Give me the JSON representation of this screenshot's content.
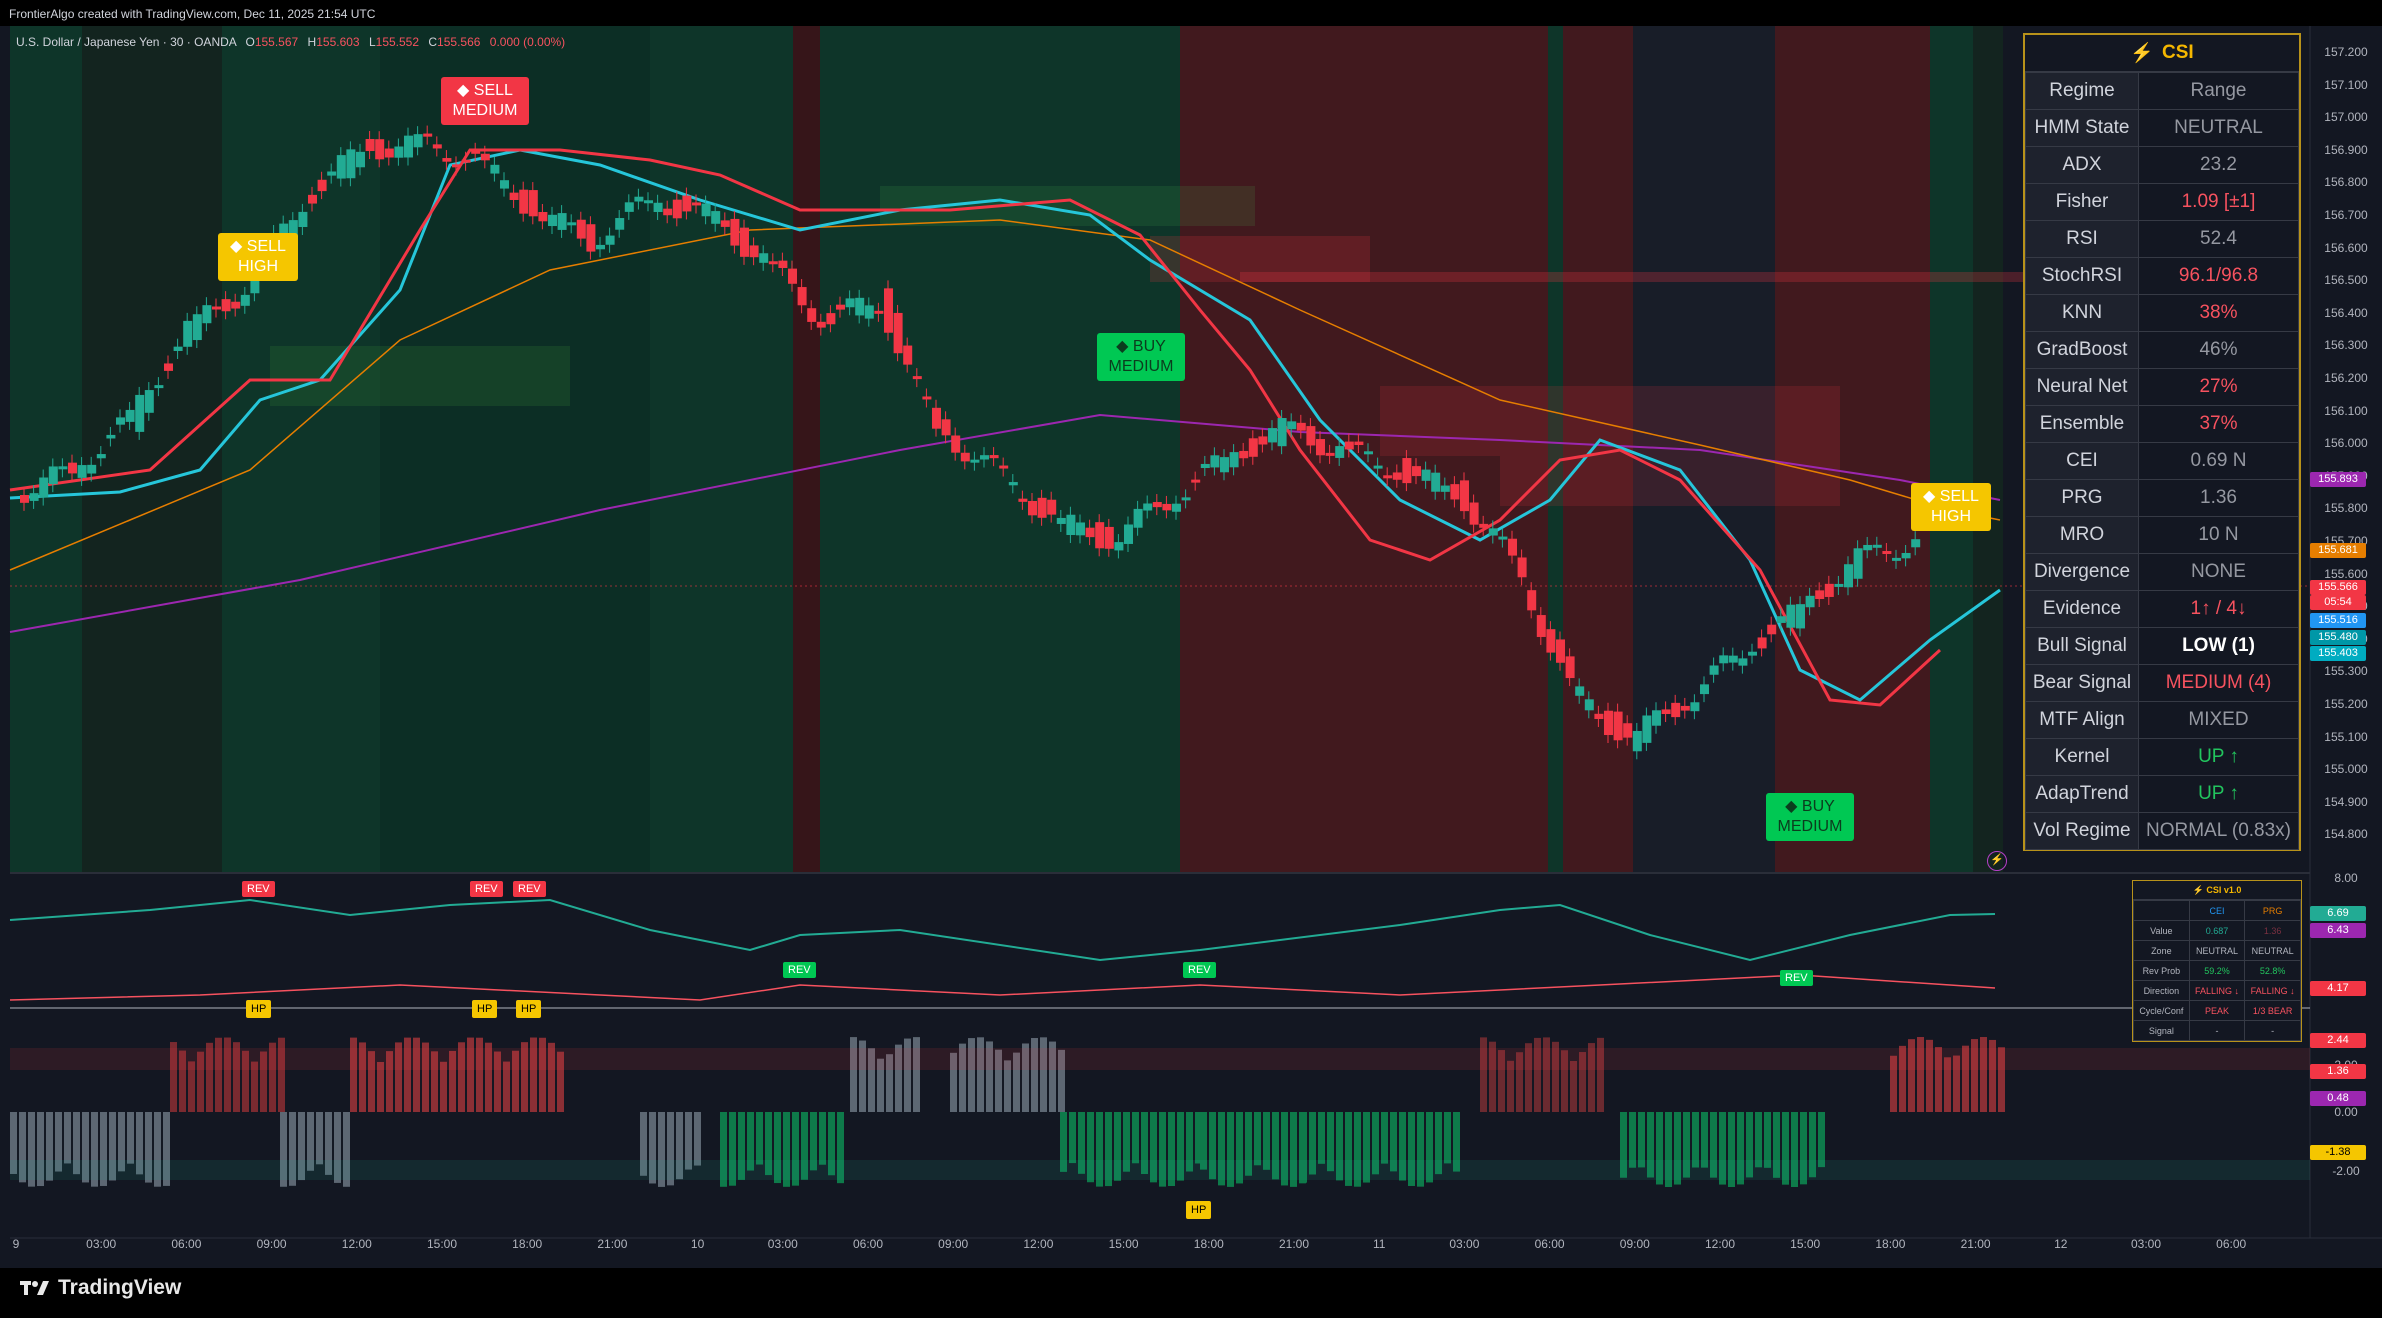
{
  "topbar": {
    "text": "FrontierAlgo created with TradingView.com, Dec 11, 2025 21:54 UTC"
  },
  "symbol": {
    "name": "U.S. Dollar / Japanese Yen · 30 · OANDA",
    "o_label": "O",
    "o": "155.567",
    "h_label": "H",
    "h": "155.603",
    "l_label": "L",
    "l": "155.552",
    "c_label": "C",
    "c": "155.566",
    "change": "0.000 (0.00%)"
  },
  "price_axis": [
    "157.200",
    "157.100",
    "157.000",
    "156.900",
    "156.800",
    "156.700",
    "156.600",
    "156.500",
    "156.400",
    "156.300",
    "156.200",
    "156.100",
    "156.000",
    "155.900",
    "155.800",
    "155.700",
    "155.600",
    "155.500",
    "155.400",
    "155.300",
    "155.200",
    "155.100",
    "155.000",
    "154.900",
    "154.800"
  ],
  "price_tags": [
    {
      "text": "155.893",
      "color": "#9c27b0"
    },
    {
      "text": "155.681",
      "color": "#e67e00"
    },
    {
      "text": "155.566",
      "color": "#f23645"
    },
    {
      "text": "05:54",
      "color": "#f23645"
    },
    {
      "text": "155.516",
      "color": "#2196f3"
    },
    {
      "text": "155.480",
      "color": "#0097a7"
    },
    {
      "text": "155.403",
      "color": "#00acc1"
    }
  ],
  "osc_axis": {
    "top": "8.00",
    "v1": "2.00",
    "v2": "0.00",
    "v3": "-2.00"
  },
  "osc_tags": [
    {
      "text": "6.69",
      "color": "#22ab94"
    },
    {
      "text": "6.43",
      "color": "#9c27b0"
    },
    {
      "text": "4.17",
      "color": "#f23645"
    },
    {
      "text": "2.44",
      "color": "#f23645"
    },
    {
      "text": "1.36",
      "color": "#f23645"
    },
    {
      "text": "0.48",
      "color": "#9c27b0"
    },
    {
      "text": "-1.38",
      "color": "#f5c600"
    }
  ],
  "time_axis": [
    "9",
    "03:00",
    "06:00",
    "09:00",
    "12:00",
    "15:00",
    "18:00",
    "21:00",
    "10",
    "03:00",
    "06:00",
    "09:00",
    "12:00",
    "15:00",
    "18:00",
    "21:00",
    "11",
    "03:00",
    "06:00",
    "09:00",
    "12:00",
    "15:00",
    "18:00",
    "21:00",
    "12",
    "03:00",
    "06:00"
  ],
  "signals": [
    {
      "line1": "◆ SELL",
      "line2": "HIGH",
      "bg": "#f5c600",
      "fg": "#ffffff"
    },
    {
      "line1": "◆ SELL",
      "line2": "MEDIUM",
      "bg": "#f23645",
      "fg": "#ffffff"
    },
    {
      "line1": "◆ BUY",
      "line2": "MEDIUM",
      "bg": "#00c853",
      "fg": "#0b3d1e"
    },
    {
      "line1": "◆ SELL",
      "line2": "HIGH",
      "bg": "#f5c600",
      "fg": "#ffffff"
    },
    {
      "line1": "◆ BUY",
      "line2": "MEDIUM",
      "bg": "#00c853",
      "fg": "#0b3d1e"
    }
  ],
  "rev_tags": [
    "REV",
    "REV",
    "REV",
    "REV",
    "REV",
    "REV"
  ],
  "hp_tags": [
    "HP",
    "HP",
    "HP",
    "HP"
  ],
  "csi": {
    "title": "CSI",
    "rows": [
      {
        "k": "Regime",
        "v": "Range",
        "c": "#9598a1"
      },
      {
        "k": "HMM State",
        "v": "NEUTRAL",
        "c": "#9598a1"
      },
      {
        "k": "ADX",
        "v": "23.2",
        "c": "#9598a1"
      },
      {
        "k": "Fisher",
        "v": "1.09 [±1]",
        "c": "#f7525f"
      },
      {
        "k": "RSI",
        "v": "52.4",
        "c": "#9598a1"
      },
      {
        "k": "StochRSI",
        "v": "96.1/96.8",
        "c": "#f7525f"
      },
      {
        "k": "KNN",
        "v": "38%",
        "c": "#f7525f"
      },
      {
        "k": "GradBoost",
        "v": "46%",
        "c": "#9598a1"
      },
      {
        "k": "Neural Net",
        "v": "27%",
        "c": "#f7525f"
      },
      {
        "k": "Ensemble",
        "v": "37%",
        "c": "#f7525f"
      },
      {
        "k": "CEI",
        "v": "0.69 N",
        "c": "#9598a1"
      },
      {
        "k": "PRG",
        "v": "1.36",
        "c": "#9598a1"
      },
      {
        "k": "MRO",
        "v": "10 N",
        "c": "#9598a1"
      },
      {
        "k": "Divergence",
        "v": "NONE",
        "c": "#9598a1"
      },
      {
        "k": "Evidence",
        "v": "1↑ / 4↓",
        "c": "#f7525f"
      },
      {
        "k": "Bull Signal",
        "v": "LOW (1)",
        "c": "#ffffff"
      },
      {
        "k": "Bear Signal",
        "v": "MEDIUM (4)",
        "c": "#f7525f"
      },
      {
        "k": "MTF Align",
        "v": "MIXED",
        "c": "#9598a1"
      },
      {
        "k": "Kernel",
        "v": "UP ↑",
        "c": "#22c55e"
      },
      {
        "k": "AdapTrend",
        "v": "UP ↑",
        "c": "#22c55e"
      },
      {
        "k": "Vol Regime",
        "v": "NORMAL (0.83x)",
        "c": "#9598a1"
      }
    ]
  },
  "mini": {
    "title": "⚡ CSI v1.0",
    "cols": [
      "",
      "CEI",
      "PRG"
    ],
    "rows": [
      {
        "k": "Value",
        "a": "0.687",
        "b": "1.36",
        "ca": "#22ab94",
        "cb": "#7a3040"
      },
      {
        "k": "Zone",
        "a": "NEUTRAL",
        "b": "NEUTRAL",
        "ca": "#b2b5be",
        "cb": "#b2b5be"
      },
      {
        "k": "Rev Prob",
        "a": "59.2%",
        "b": "52.8%",
        "ca": "#22c55e",
        "cb": "#22c55e"
      },
      {
        "k": "Direction",
        "a": "FALLING ↓",
        "b": "FALLING ↓",
        "ca": "#f7525f",
        "cb": "#f7525f"
      },
      {
        "k": "Cycle/Conf",
        "a": "PEAK",
        "b": "1/3 BEAR",
        "ca": "#f7525f",
        "cb": "#f7525f"
      },
      {
        "k": "Signal",
        "a": "-",
        "b": "-",
        "ca": "#b2b5be",
        "cb": "#b2b5be"
      }
    ]
  },
  "brand": "TradingView"
}
